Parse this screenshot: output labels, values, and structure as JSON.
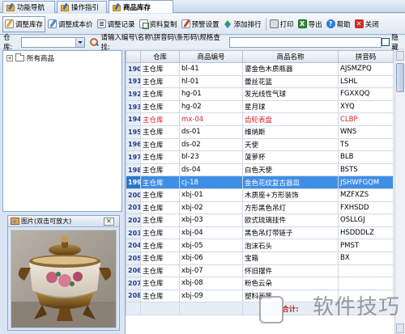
{
  "tabs": [
    {
      "label": "功能导航"
    },
    {
      "label": "操作指引"
    },
    {
      "label": "商品库存"
    }
  ],
  "toolbar": {
    "adjust_stock": "调整库存",
    "adjust_cost": "调整成本价",
    "adjust_records": "调整记录",
    "copy_data": "资料复制",
    "warning_settings": "预警设置",
    "sort": "添加排行",
    "print": "打印",
    "export": "导出",
    "help": "帮助",
    "close": "关闭"
  },
  "search": {
    "warehouse_label": "仓库:",
    "warehouse_value": "",
    "keyword_label": "请输入编号\\名称\\拼音码\\条形码\\规格查找:",
    "keyword_value": "",
    "hide_label": "隐藏"
  },
  "tree": {
    "root_label": "所有商品"
  },
  "picture_panel": {
    "title": "图片(双击可放大)"
  },
  "table": {
    "headers": [
      "",
      "仓库",
      "商品编号",
      "商品名称",
      "拼音码"
    ],
    "rows": [
      {
        "n": "190",
        "wh": "主仓库",
        "code": "bl-41",
        "name": "鎏金色木质瓶器",
        "py": "AJSMZPQ"
      },
      {
        "n": "191",
        "wh": "主仓库",
        "code": "hl-01",
        "name": "蕾丝花篮",
        "py": "LSHL"
      },
      {
        "n": "192",
        "wh": "主仓库",
        "code": "hg-01",
        "name": "发光线性气球",
        "py": "FGXXQQ"
      },
      {
        "n": "193",
        "wh": "主仓库",
        "code": "hg-02",
        "name": "星月球",
        "py": "XYQ"
      },
      {
        "n": "194",
        "wh": "主仓库",
        "code": "mx-04",
        "name": "齿轮表盘",
        "py": "CLBP"
      },
      {
        "n": "195",
        "wh": "主仓库",
        "code": "ds-01",
        "name": "维纳斯",
        "py": "WNS"
      },
      {
        "n": "196",
        "wh": "主仓库",
        "code": "ds-02",
        "name": "天使",
        "py": "TS"
      },
      {
        "n": "197",
        "wh": "主仓库",
        "code": "bl-23",
        "name": "菠萝杯",
        "py": "BLB"
      },
      {
        "n": "198",
        "wh": "主仓库",
        "code": "ds-04",
        "name": "白色天使",
        "py": "BSTS"
      },
      {
        "n": "199",
        "wh": "主仓库",
        "code": "cj-18",
        "name": "金色花纹复古器皿",
        "py": "JSHWFGQM"
      },
      {
        "n": "200",
        "wh": "主仓库",
        "code": "xbj-01",
        "name": "木质座+方形装饰",
        "py": "MZFXZS"
      },
      {
        "n": "201",
        "wh": "主仓库",
        "code": "xbj-02",
        "name": "方形黑色吊灯",
        "py": "FXHSDD"
      },
      {
        "n": "202",
        "wh": "主仓库",
        "code": "xbj-03",
        "name": "欧式琉璃挂件",
        "py": "OSLLGJ"
      },
      {
        "n": "203",
        "wh": "主仓库",
        "code": "xbj-04",
        "name": "黑色吊灯带链子",
        "py": "HSDDDLZ"
      },
      {
        "n": "204",
        "wh": "主仓库",
        "code": "xbj-05",
        "name": "泡沫石头",
        "py": "PMST"
      },
      {
        "n": "205",
        "wh": "主仓库",
        "code": "xbj-06",
        "name": "宝箱",
        "py": "BX"
      },
      {
        "n": "206",
        "wh": "主仓库",
        "code": "xbj-07",
        "name": "怀旧摆件",
        "py": ""
      },
      {
        "n": "207",
        "wh": "主仓库",
        "code": "xbj-08",
        "name": "粉色云朵",
        "py": ""
      },
      {
        "n": "208",
        "wh": "主仓库",
        "code": "xbj-09",
        "name": "塑料画筐",
        "py": ""
      }
    ],
    "total_label": "合计:",
    "selected_row": "199",
    "highlight_row": "194"
  },
  "watermark": "软件技巧",
  "colors": {
    "selection": "#3f8ee6",
    "alert_text": "#d8202a",
    "row_number": "#223a8a"
  }
}
